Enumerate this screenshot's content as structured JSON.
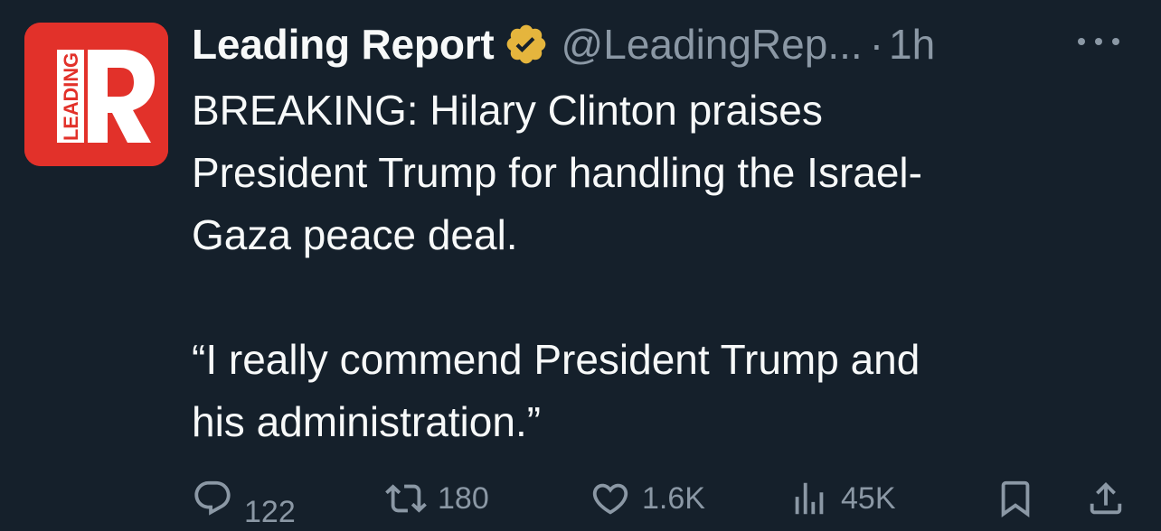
{
  "author": {
    "display_name": "Leading Report",
    "handle": "@LeadingRep...",
    "separator": "·",
    "time": "1h",
    "verified": true,
    "avatar_letter": "R",
    "avatar_text": "LEADING",
    "avatar_color": "#e2312a"
  },
  "tweet": {
    "paragraph1": "BREAKING: Hilary Clinton praises President Trump for handling the Israel-Gaza peace deal.",
    "paragraph1_lines": [
      "BREAKING: Hilary Clinton praises",
      "President Trump for handling the Israel-",
      "Gaza peace deal."
    ],
    "paragraph2_lines": [
      "“I really commend President Trump and",
      "his administration.”"
    ]
  },
  "actions": {
    "replies": "122",
    "retweets": "180",
    "likes": "1.6K",
    "views": "45K"
  },
  "colors": {
    "background": "#15202b",
    "text": "#f7f9f9",
    "muted": "#8b98a5",
    "verified_badge": "#e5b53d"
  }
}
